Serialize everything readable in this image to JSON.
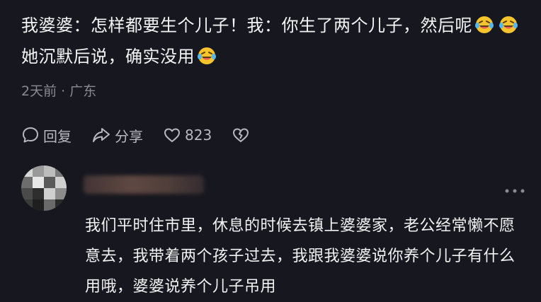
{
  "comment": {
    "author": "我婆婆",
    "text_part1": "：怎样都要生个儿子！我：你生了两个儿子，然后呢",
    "text_part2": "她沉默后说，确实没用",
    "time": "2天前",
    "separator": "·",
    "location": "广东"
  },
  "actions": {
    "reply_label": "回复",
    "share_label": "分享",
    "like_count": "823"
  },
  "reply": {
    "text": "我们平时住市里，休息的时候去镇上婆婆家，老公经常懒不愿意去，我带着两个孩子过去，我跟我婆婆说你养个儿子有什么用哦，婆婆说养个儿子吊用"
  },
  "icons": {
    "emoji": "laughing-tears-icon",
    "reply": "comment-bubble-icon",
    "share": "share-arrow-icon",
    "like": "heart-icon",
    "dislike": "broken-heart-icon",
    "more": "more-dots-icon"
  },
  "colors": {
    "background": "#17171f",
    "text": "#f4f4f4",
    "meta": "#8a8a92",
    "emoji": "#f7c52b"
  }
}
